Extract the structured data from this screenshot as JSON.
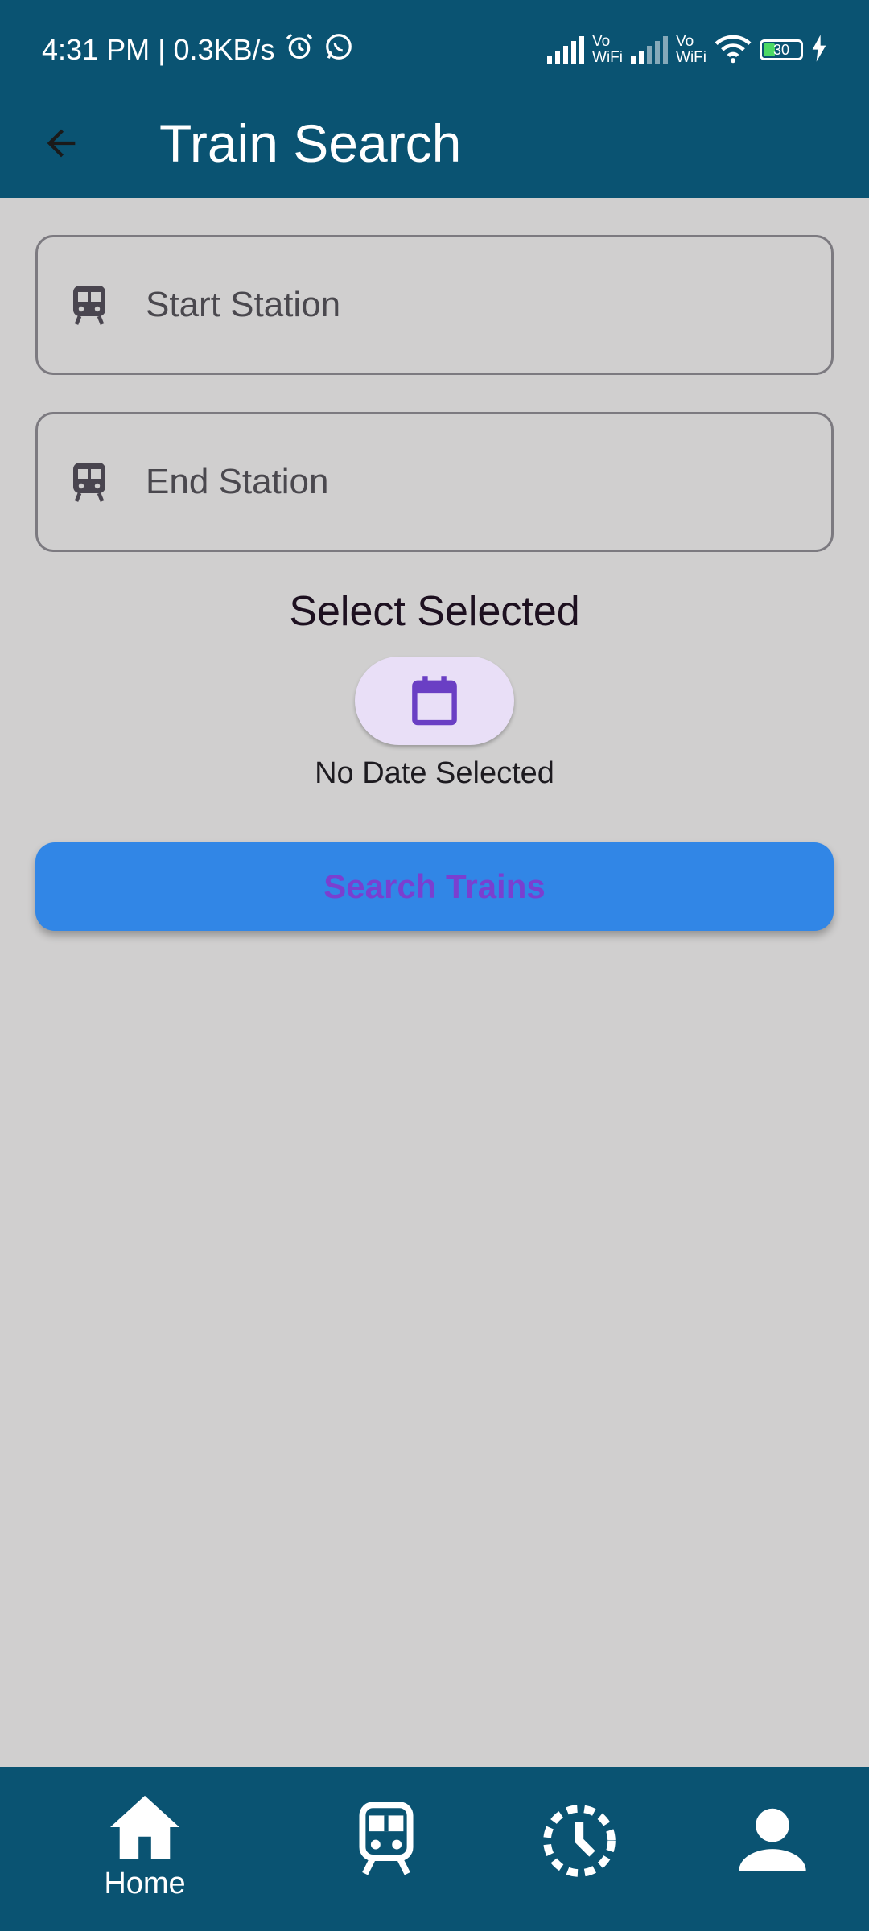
{
  "status_bar": {
    "time": "4:31 PM",
    "separator": "|",
    "speed": "0.3KB/s",
    "vowifi_1_top": "Vo",
    "vowifi_1_bottom": "WiFi",
    "vowifi_2_top": "Vo",
    "vowifi_2_bottom": "WiFi",
    "battery": "30"
  },
  "app_bar": {
    "title": "Train Search"
  },
  "form": {
    "start_station_placeholder": "Start Station",
    "end_station_placeholder": "End Station",
    "select_label": "Select Selected",
    "date_text": "No Date Selected",
    "search_button": "Search Trains"
  },
  "bottom_nav": {
    "items": [
      {
        "label": "Home",
        "icon": "home-icon",
        "selected": true
      },
      {
        "label": "",
        "icon": "train-icon",
        "selected": false
      },
      {
        "label": "",
        "icon": "history-icon",
        "selected": false
      },
      {
        "label": "",
        "icon": "person-icon",
        "selected": false
      }
    ]
  },
  "colors": {
    "primary": "#0a5372",
    "background": "#d0cfcf",
    "search_button": "#3186e6",
    "search_text": "#7a3fd0",
    "date_button": "#e9dff7",
    "calendar_icon": "#6a3fc4"
  }
}
